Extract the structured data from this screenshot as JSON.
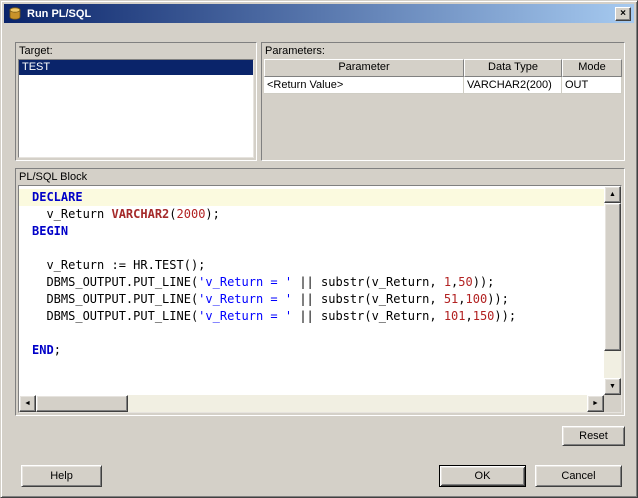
{
  "window": {
    "title": "Run PL/SQL"
  },
  "icons": {
    "close": "×",
    "scroll_up": "▲",
    "scroll_down": "▼",
    "scroll_left": "◄",
    "scroll_right": "►"
  },
  "target": {
    "label": "Target:",
    "items": [
      {
        "name": "TEST",
        "selected": true
      }
    ]
  },
  "parameters": {
    "label": "Parameters:",
    "columns": [
      "Parameter",
      "Data Type",
      "Mode"
    ],
    "rows": [
      [
        "<Return Value>",
        "VARCHAR2(200)",
        "OUT"
      ]
    ]
  },
  "plsql_block": {
    "label": "PL/SQL Block",
    "lines": [
      {
        "current": true,
        "tokens": [
          {
            "t": "kw",
            "v": "DECLARE"
          }
        ]
      },
      {
        "tokens": [
          {
            "t": "pl",
            "v": "  v_Return "
          },
          {
            "t": "ty",
            "v": "VARCHAR2"
          },
          {
            "t": "pl",
            "v": "("
          },
          {
            "t": "nu",
            "v": "2000"
          },
          {
            "t": "pl",
            "v": ");"
          }
        ]
      },
      {
        "tokens": [
          {
            "t": "kw",
            "v": "BEGIN"
          }
        ]
      },
      {
        "tokens": []
      },
      {
        "tokens": [
          {
            "t": "pl",
            "v": "  v_Return := HR.TEST();"
          }
        ]
      },
      {
        "tokens": [
          {
            "t": "pl",
            "v": "  DBMS_OUTPUT.PUT_LINE("
          },
          {
            "t": "st",
            "v": "'v_Return = '"
          },
          {
            "t": "pl",
            "v": " || substr(v_Return, "
          },
          {
            "t": "nu",
            "v": "1"
          },
          {
            "t": "pl",
            "v": ","
          },
          {
            "t": "nu",
            "v": "50"
          },
          {
            "t": "pl",
            "v": "));"
          }
        ]
      },
      {
        "tokens": [
          {
            "t": "pl",
            "v": "  DBMS_OUTPUT.PUT_LINE("
          },
          {
            "t": "st",
            "v": "'v_Return = '"
          },
          {
            "t": "pl",
            "v": " || substr(v_Return, "
          },
          {
            "t": "nu",
            "v": "51"
          },
          {
            "t": "pl",
            "v": ","
          },
          {
            "t": "nu",
            "v": "100"
          },
          {
            "t": "pl",
            "v": "));"
          }
        ]
      },
      {
        "tokens": [
          {
            "t": "pl",
            "v": "  DBMS_OUTPUT.PUT_LINE("
          },
          {
            "t": "st",
            "v": "'v_Return = '"
          },
          {
            "t": "pl",
            "v": " || substr(v_Return, "
          },
          {
            "t": "nu",
            "v": "101"
          },
          {
            "t": "pl",
            "v": ","
          },
          {
            "t": "nu",
            "v": "150"
          },
          {
            "t": "pl",
            "v": "));"
          }
        ]
      },
      {
        "tokens": []
      },
      {
        "tokens": [
          {
            "t": "kw",
            "v": "END"
          },
          {
            "t": "pl",
            "v": ";"
          }
        ]
      }
    ]
  },
  "buttons": {
    "reset": "Reset",
    "help": "Help",
    "ok": "OK",
    "cancel": "Cancel"
  },
  "colors": {
    "titlebar_start": "#0A246A",
    "titlebar_end": "#A6CAF0",
    "selection_bg": "#0A246A",
    "keyword": "#0000C8",
    "datatype": "#A52A2A",
    "string": "#0000FF",
    "number": "#B22222",
    "current_line_bg": "#FBFADF"
  }
}
